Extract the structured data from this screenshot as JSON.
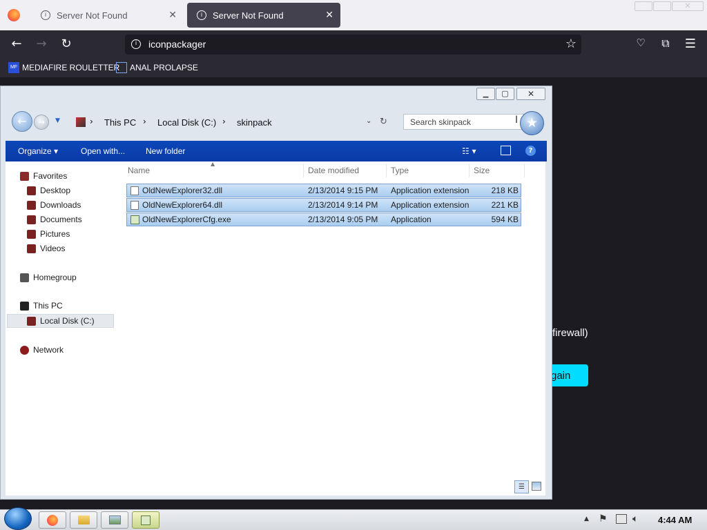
{
  "browser": {
    "tabs": [
      {
        "label": "Server Not Found",
        "close": "✕"
      },
      {
        "label": "Server Not Found",
        "close": "✕"
      }
    ],
    "url": "iconpackager",
    "bookmarks": [
      {
        "label": "MEDIAFIRE ROULETTER",
        "icon_text": "MF"
      },
      {
        "label": "ANAL PROLAPSE"
      }
    ],
    "page_text": {
      "firewall": "firewall)",
      "button": "gain"
    }
  },
  "explorer": {
    "breadcrumb": [
      "This PC",
      "Local Disk (C:)",
      "skinpack"
    ],
    "search_placeholder": "Search skinpack",
    "toolbar": {
      "organize": "Organize ▾",
      "open_with": "Open with...",
      "new_folder": "New folder"
    },
    "sidebar": {
      "favorites": "Favorites",
      "items": [
        "Desktop",
        "Downloads",
        "Documents",
        "Pictures",
        "Videos"
      ],
      "homegroup": "Homegroup",
      "this_pc": "This PC",
      "local_disk": "Local Disk (C:)",
      "network": "Network"
    },
    "columns": [
      "Name",
      "Date modified",
      "Type",
      "Size"
    ],
    "files": [
      {
        "name": "OldNewExplorer32.dll",
        "date": "2/13/2014 9:15 PM",
        "type": "Application extension",
        "size": "218 KB"
      },
      {
        "name": "OldNewExplorer64.dll",
        "date": "2/13/2014 9:14 PM",
        "type": "Application extension",
        "size": "221 KB"
      },
      {
        "name": "OldNewExplorerCfg.exe",
        "date": "2/13/2014 9:05 PM",
        "type": "Application",
        "size": "594 KB"
      }
    ]
  },
  "taskbar": {
    "clock": "4:44 AM"
  },
  "colors": {
    "accent": "#0a3aa6",
    "selection": "#cfe3f7",
    "tab_active": "#42414d",
    "button": "#00ddff"
  }
}
